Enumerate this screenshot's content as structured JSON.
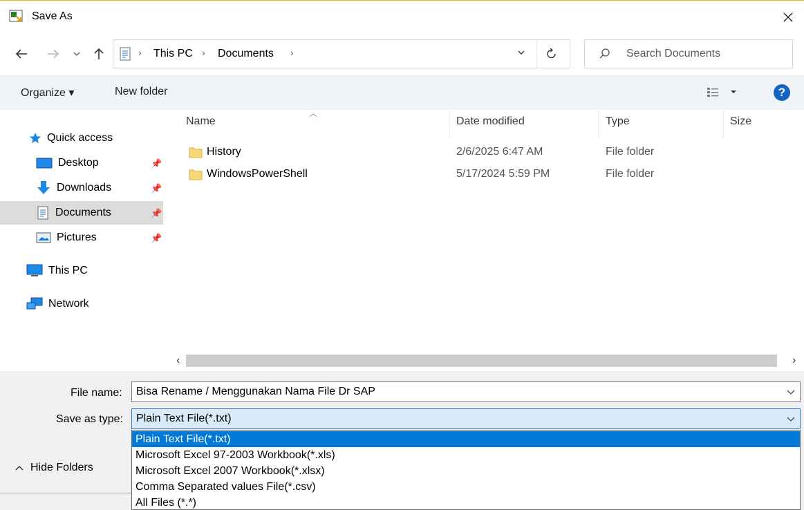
{
  "window": {
    "title": "Save As",
    "icon": "app-icon"
  },
  "navigation": {
    "back_icon": "back-arrow-icon",
    "forward_icon": "forward-arrow-icon",
    "recent_icon": "chevron-down-icon",
    "up_icon": "up-arrow-icon",
    "breadcrumb": [
      "This PC",
      "Documents"
    ],
    "search_placeholder": "Search Documents"
  },
  "toolbar": {
    "organize_label": "Organize ▾",
    "new_folder_label": "New folder",
    "help_label": "?"
  },
  "sidebar": {
    "items": [
      {
        "label": "Quick access",
        "icon": "star-icon",
        "pinned": false
      },
      {
        "label": "Desktop",
        "icon": "desktop-icon",
        "pinned": true
      },
      {
        "label": "Downloads",
        "icon": "download-icon",
        "pinned": true
      },
      {
        "label": "Documents",
        "icon": "documents-icon",
        "pinned": true,
        "selected": true
      },
      {
        "label": "Pictures",
        "icon": "pictures-icon",
        "pinned": true
      },
      {
        "label": "This PC",
        "icon": "computer-icon",
        "pinned": false
      },
      {
        "label": "Network",
        "icon": "network-icon",
        "pinned": false
      }
    ]
  },
  "file_list": {
    "columns": [
      "Name",
      "Date modified",
      "Type",
      "Size"
    ],
    "rows": [
      {
        "name": "History",
        "date": "2/6/2025 6:47 AM",
        "type": "File folder"
      },
      {
        "name": "WindowsPowerShell",
        "date": "5/17/2024 5:59 PM",
        "type": "File folder"
      }
    ]
  },
  "save_panel": {
    "file_name_label": "File name:",
    "file_name_value": "Bisa Rename / Menggunakan Nama File Dr SAP",
    "save_type_label": "Save as type:",
    "save_type_value": "Plain Text File(*.txt)",
    "type_options": [
      "Plain Text File(*.txt)",
      "Microsoft Excel 97-2003 Workbook(*.xls)",
      "Microsoft Excel 2007 Workbook(*.xlsx)",
      "Comma Separated values File(*.csv)",
      "All Files (*.*)"
    ],
    "hide_folders_label": "Hide Folders"
  },
  "colors": {
    "accent": "#0078d7",
    "help": "#1565c0",
    "folder": "#f8d775"
  }
}
